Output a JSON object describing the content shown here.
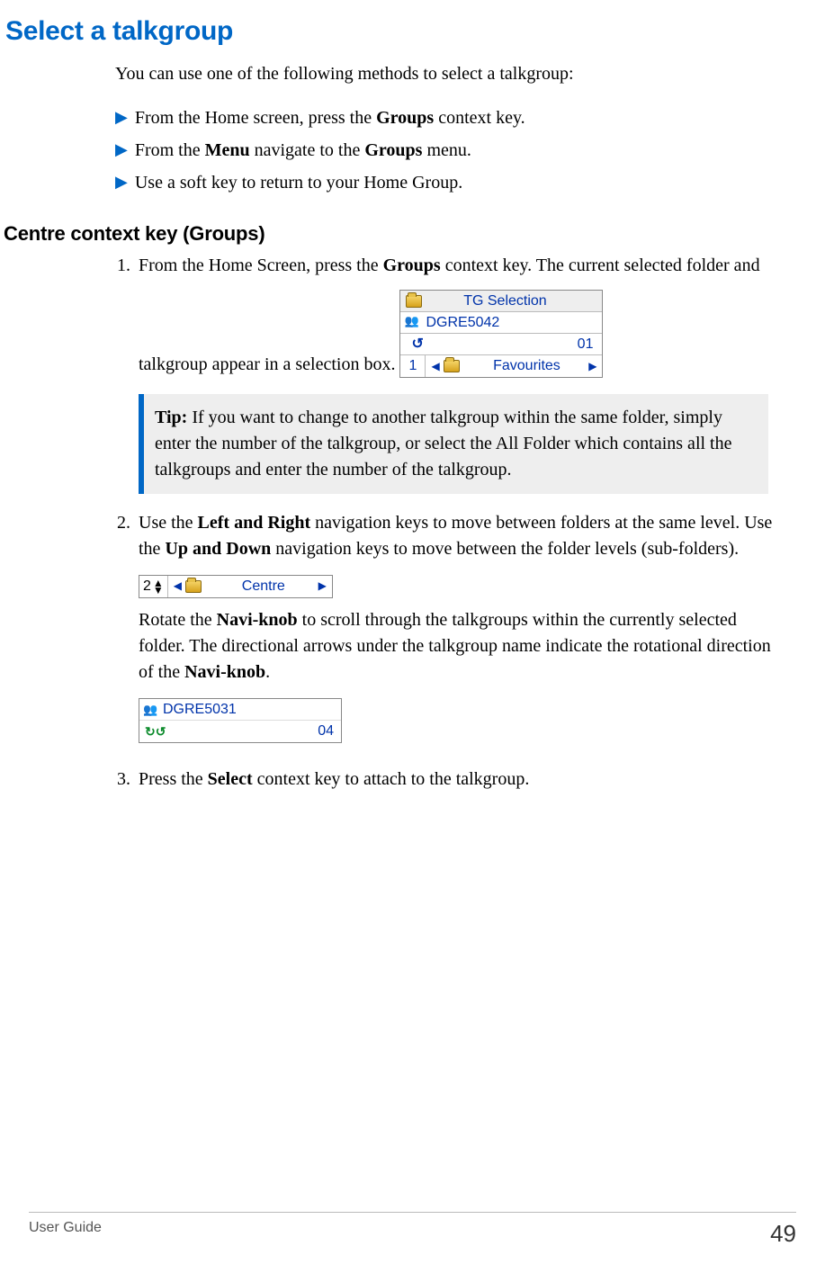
{
  "title": "Select a talkgroup",
  "intro": "You can use one of the following methods to select a talkgroup:",
  "bullets": [
    {
      "pre": "From the Home screen, press the ",
      "bold": "Groups",
      "post": " context key."
    },
    {
      "pre": "From the ",
      "bold": "Menu",
      "mid": " navigate to the ",
      "bold2": "Groups",
      "post": " menu."
    },
    {
      "pre": "Use a soft key to return to your Home Group.",
      "bold": "",
      "post": ""
    }
  ],
  "subhead": "Centre context key (Groups)",
  "step1": {
    "pre": "From the Home Screen, press the ",
    "bold": "Groups",
    "post": " context key. The current selected folder and talkgroup appear in a selection box."
  },
  "fig1": {
    "title": "TG Selection",
    "talkgroup": "DGRE5042",
    "count": "01",
    "footer_num": "1",
    "footer_label": "Favourites"
  },
  "tip": {
    "label": "Tip:",
    "text": " If you want to change to another talkgroup within the same folder, simply enter the number of the talkgroup, or select the All Folder which contains all the talkgroups and enter the number of the talkgroup."
  },
  "step2": {
    "pre": "Use the ",
    "b1": "Left and Right",
    "mid1": " navigation keys to move between folders at the same level. Use the ",
    "b2": "Up and Down",
    "mid2": " navigation keys to move between the folder levels (sub-folders)."
  },
  "fig2": {
    "num": "2",
    "label": "Centre"
  },
  "step2_after": {
    "pre": "Rotate the ",
    "b1": "Navi-knob",
    "mid": " to scroll through the talkgroups within the currently selected folder. The directional arrows under the talkgroup name indicate the rotational direction of the ",
    "b2": "Navi-knob",
    "post": "."
  },
  "fig3": {
    "name": "DGRE5031",
    "count": "04"
  },
  "step3": {
    "pre": "Press the ",
    "bold": "Select",
    "post": " context key to attach to the talkgroup."
  },
  "footer": {
    "left": "User Guide",
    "page": "49"
  }
}
